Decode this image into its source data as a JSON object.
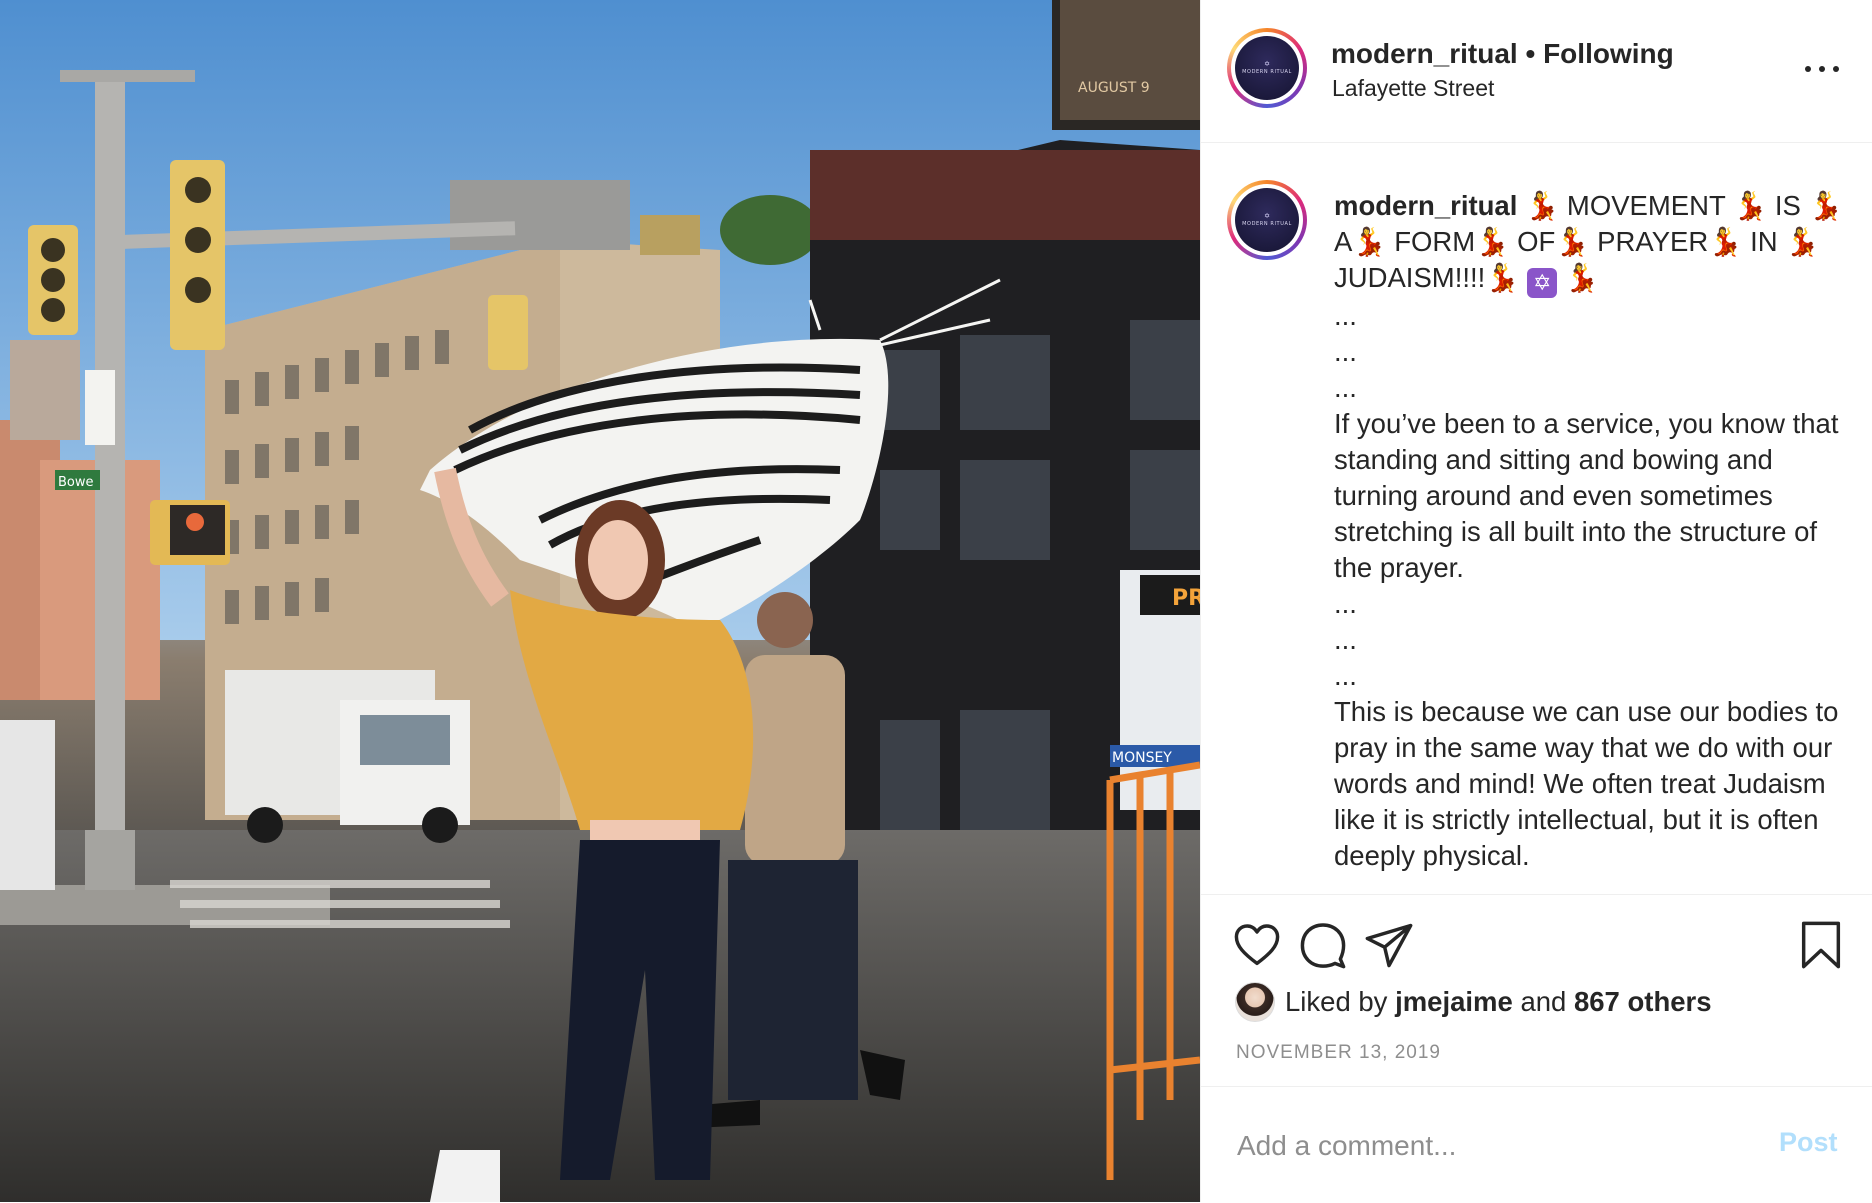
{
  "photo": {
    "billboard_text": "AUGUST 9",
    "street_sign": "Bowe",
    "bus_sign": "PR",
    "bus_side": "MONSEY"
  },
  "header": {
    "username": "modern_ritual",
    "separator": " • ",
    "follow_status": "Following",
    "location": "Lafayette Street",
    "avatar_logo_text": "MODERN RITUAL"
  },
  "caption": {
    "username": "modern_ritual",
    "emoji_name": "woman-dancing-icon",
    "first_line": [
      {
        "text": " MOVEMENT "
      },
      {
        "text": " IS "
      },
      {
        "text": " A"
      },
      {
        "text": " FORM"
      },
      {
        "text": " OF"
      },
      {
        "text": " PRAYER"
      },
      {
        "text": " IN "
      },
      {
        "text": " JUDAISM!!!!"
      }
    ],
    "ellipsis": "...",
    "para1": "If you’ve been to a service, you know that standing and sitting and bowing and turning around and even sometimes stretching is all built into the structure of the prayer.",
    "para2": "This is because we can use our bodies to pray in the same way that we do with our words and mind! We often treat Judaism like it is strictly intellectual, but it is often deeply physical."
  },
  "actions": {
    "like_icon": "heart-icon",
    "comment_icon": "comment-icon",
    "share_icon": "paper-plane-icon",
    "save_icon": "bookmark-icon"
  },
  "likes": {
    "prefix": "Liked by ",
    "user": "jmejaime",
    "middle": " and ",
    "others": "867 others"
  },
  "date": "NOVEMBER 13, 2019",
  "comment": {
    "placeholder": "Add a comment...",
    "post_label": "Post"
  },
  "colors": {
    "text": "#262626",
    "secondary": "#8e8e8e",
    "post_disabled": "#b2dffc",
    "border": "#efefef"
  }
}
